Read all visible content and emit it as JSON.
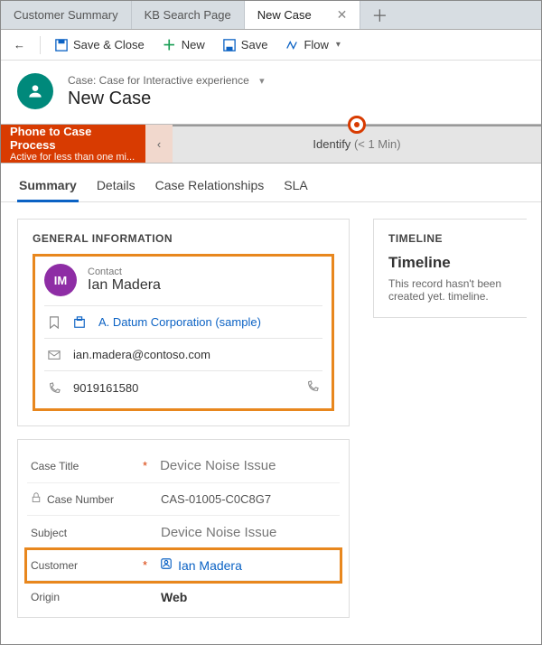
{
  "tabs": [
    {
      "label": "Customer Summary"
    },
    {
      "label": "KB Search Page"
    },
    {
      "label": "New Case"
    }
  ],
  "toolbar": {
    "back": "←",
    "save_close": "Save & Close",
    "new": "New",
    "save": "Save",
    "flow": "Flow"
  },
  "header": {
    "entity": "Case: Case for Interactive experience",
    "title": "New Case"
  },
  "process": {
    "name": "Phone to Case Process",
    "status": "Active for less than one mi...",
    "stage": "Identify",
    "dur": "(< 1 Min)"
  },
  "subtabs": [
    "Summary",
    "Details",
    "Case Relationships",
    "SLA"
  ],
  "general": {
    "section": "GENERAL INFORMATION",
    "contact_label": "Contact",
    "contact_initials": "IM",
    "contact_name": "Ian Madera",
    "company": "A. Datum Corporation (sample)",
    "email": "ian.madera@contoso.com",
    "phone": "9019161580"
  },
  "timeline": {
    "section": "TIMELINE",
    "title": "Timeline",
    "msg": "This record hasn't been created yet. timeline."
  },
  "fields": {
    "case_title_label": "Case Title",
    "case_title": "Device Noise Issue",
    "case_number_label": "Case Number",
    "case_number": "CAS-01005-C0C8G7",
    "subject_label": "Subject",
    "subject": "Device Noise Issue",
    "customer_label": "Customer",
    "customer": "Ian Madera",
    "origin_label": "Origin",
    "origin": "Web"
  }
}
